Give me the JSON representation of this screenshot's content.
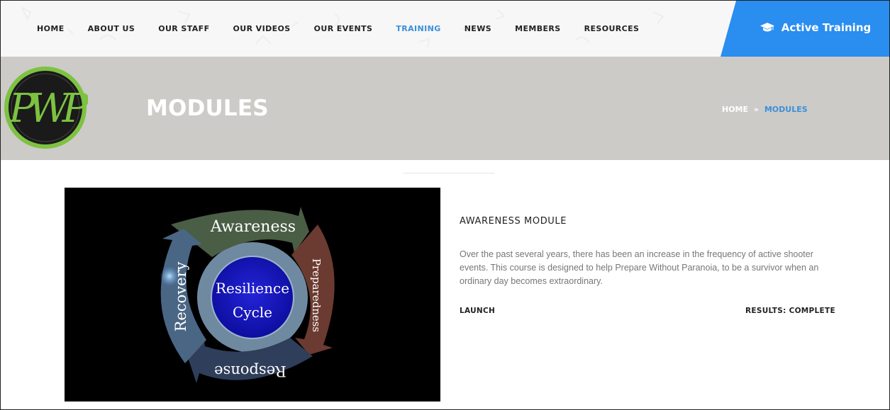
{
  "nav": {
    "items": [
      {
        "label": "HOME",
        "active": false
      },
      {
        "label": "ABOUT US",
        "active": false
      },
      {
        "label": "OUR STAFF",
        "active": false
      },
      {
        "label": "OUR VIDEOS",
        "active": false
      },
      {
        "label": "OUR EVENTS",
        "active": false
      },
      {
        "label": "TRAINING",
        "active": true
      },
      {
        "label": "NEWS",
        "active": false
      },
      {
        "label": "MEMBERS",
        "active": false
      },
      {
        "label": "RESOURCES",
        "active": false
      }
    ],
    "cta_label": "Active Training",
    "cta_icon": "graduation-cap-icon"
  },
  "banner": {
    "logo_text": "PWP",
    "title": "MODULES",
    "breadcrumb": {
      "home": "HOME",
      "separator": "»",
      "current": "MODULES"
    }
  },
  "module": {
    "image": {
      "center_line1": "Resilience",
      "center_line2": "Cycle",
      "top": "Awareness",
      "right": "Preparedness",
      "bottom": "Response",
      "left": "Recovery"
    },
    "title": "AWARENESS MODULE",
    "description": "Over the past several years, there has been an increase in the frequency of active shooter events. This course is designed to help Prepare Without Paranoia, to be a survivor when an ordinary day becomes extraordinary.",
    "launch_label": "LAUNCH",
    "results_label": "RESULTS: COMPLETE"
  },
  "colors": {
    "accent": "#2a8df0",
    "active_link": "#3b8fd8",
    "banner_bg": "#cccbc7",
    "awareness": "#4a5d45",
    "preparedness": "#6b3a30",
    "response": "#2f3e5a",
    "recovery": "#4a6685"
  }
}
